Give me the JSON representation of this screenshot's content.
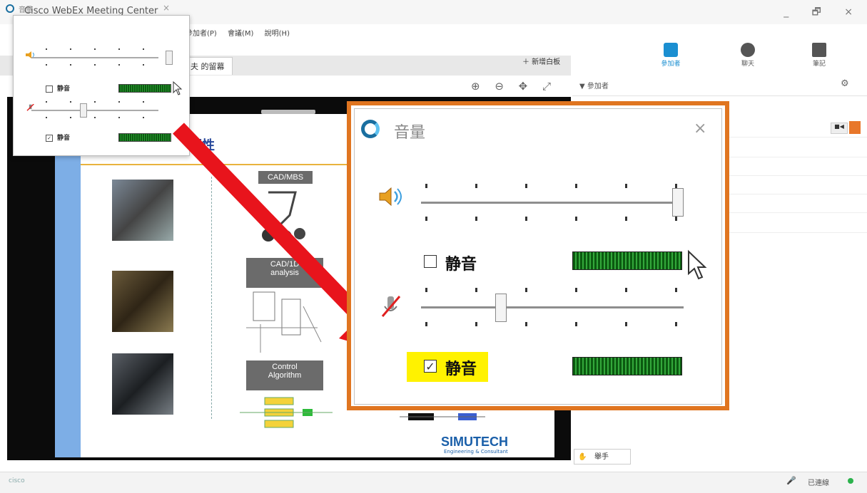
{
  "window": {
    "app_title": "Cisco WebEx Meeting Center",
    "controls": "_ 🗗 ×"
  },
  "menu": {
    "items": [
      "參加者(P)",
      "會議(M)",
      "說明(H)"
    ]
  },
  "right_tabs": [
    {
      "label": "參加者",
      "icon": "participants-icon"
    },
    {
      "label": "聊天",
      "icon": "chat-icon"
    },
    {
      "label": "筆記",
      "icon": "notes-icon"
    }
  ],
  "share": {
    "tab_label": "夫 的留幕",
    "new_whiteboard": "＋ 新增白板",
    "nav_icons": "⊕ ⊖ ✥ ⤢"
  },
  "slide": {
    "title": "要性",
    "boxes": {
      "cad": "CAD/MBS",
      "cad1d": "CAD/1D\nanalysis",
      "control": "Control\nAlgorithm"
    },
    "brand": "SIMUTECH",
    "brand_sub": "Engineering & Consultant"
  },
  "panel": {
    "header": "▼ 參加者",
    "gear_icon": "⚙",
    "raise_hand": "舉手"
  },
  "status": {
    "logo": "cisco",
    "text": "已連線"
  },
  "volume_popup": {
    "title": "音量",
    "close": "×",
    "speaker": {
      "mute_label": "静音",
      "muted": false,
      "level": 1.0
    },
    "microphone": {
      "mute_label": "静音",
      "muted": true,
      "level": 0.3
    }
  },
  "colors": {
    "accent": "#1b8fd1",
    "frame": "#e07520",
    "highlight": "#fff200",
    "arrow": "#e8141c",
    "meter": "#2a9b32"
  }
}
